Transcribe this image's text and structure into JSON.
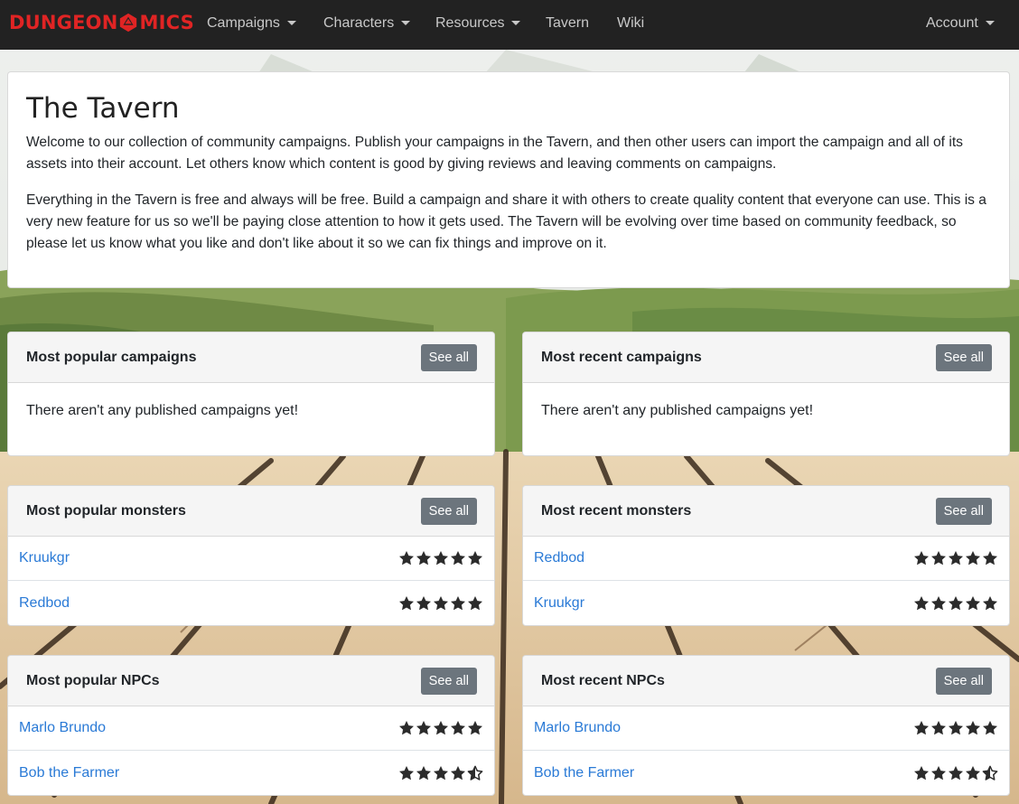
{
  "brand": {
    "name_left": "DUNGEON",
    "name_right": "MICS",
    "logo_icon": "d20-icon"
  },
  "nav": {
    "items": [
      {
        "label": "Campaigns",
        "dropdown": true
      },
      {
        "label": "Characters",
        "dropdown": true
      },
      {
        "label": "Resources",
        "dropdown": true
      },
      {
        "label": "Tavern",
        "dropdown": false
      },
      {
        "label": "Wiki",
        "dropdown": false
      }
    ],
    "account": {
      "label": "Account",
      "dropdown": true
    }
  },
  "intro": {
    "title": "The Tavern",
    "p1": "Welcome to our collection of community campaigns. Publish your campaigns in the Tavern, and then other users can import the campaign and all of its assets into their account. Let others know which content is good by giving reviews and leaving comments on campaigns.",
    "p2": "Everything in the Tavern is free and always will be free. Build a campaign and share it with others to create quality content that everyone can use. This is a very new feature for us so we'll be paying close attention to how it gets used. The Tavern will be evolving over time based on community feedback, so please let us know what you like and don't like about it so we can fix things and improve on it."
  },
  "see_all_label": "See all",
  "panels": {
    "popular_campaigns": {
      "title": "Most popular campaigns",
      "empty": "There aren't any published campaigns yet!"
    },
    "recent_campaigns": {
      "title": "Most recent campaigns",
      "empty": "There aren't any published campaigns yet!"
    },
    "popular_monsters": {
      "title": "Most popular monsters",
      "items": [
        {
          "name": "Kruukgr",
          "rating": 5
        },
        {
          "name": "Redbod",
          "rating": 5
        }
      ]
    },
    "recent_monsters": {
      "title": "Most recent monsters",
      "items": [
        {
          "name": "Redbod",
          "rating": 5
        },
        {
          "name": "Kruukgr",
          "rating": 5
        }
      ]
    },
    "popular_npcs": {
      "title": "Most popular NPCs",
      "items": [
        {
          "name": "Marlo Brundo",
          "rating": 5
        },
        {
          "name": "Bob the Farmer",
          "rating": 4.5
        }
      ]
    },
    "recent_npcs": {
      "title": "Most recent NPCs",
      "items": [
        {
          "name": "Marlo Brundo",
          "rating": 5
        },
        {
          "name": "Bob the Farmer",
          "rating": 4.5
        }
      ]
    }
  },
  "colors": {
    "navbar": "#222222",
    "brand": "#e02424",
    "link": "#2a7ad6",
    "button": "#6c757d",
    "star": "#2b2b2b"
  }
}
